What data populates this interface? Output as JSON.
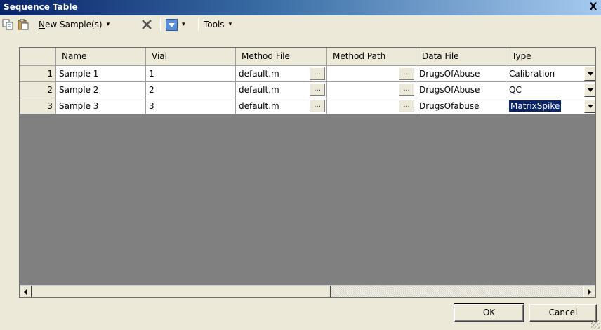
{
  "window": {
    "title": "Sequence Table",
    "close_glyph": "X"
  },
  "toolbar": {
    "copy_icon": "copy-icon",
    "paste_icon": "paste-icon",
    "new_sample_prefix": "N",
    "new_sample_rest": "ew Sample(s)",
    "delete_icon": "delete-x-icon",
    "insert_icon": "insert-down-icon",
    "tools_label": "Tools",
    "dropdown_glyph": "▾"
  },
  "table": {
    "columns": [
      "Name",
      "Vial",
      "Method File",
      "Method Path",
      "Data File",
      "Type"
    ],
    "ellipsis_label": "...",
    "rows": [
      {
        "num": "1",
        "name": "Sample 1",
        "vial": "1",
        "method_file": "default.m",
        "method_path": "",
        "data_file": "DrugsOfAbuse",
        "type": "Calibration"
      },
      {
        "num": "2",
        "name": "Sample 2",
        "vial": "2",
        "method_file": "default.m",
        "method_path": "",
        "data_file": "DrugsOfAbuse",
        "type": "QC"
      },
      {
        "num": "3",
        "name": "Sample 3",
        "vial": "3",
        "method_file": "default.m",
        "method_path": "",
        "data_file": "DrugsOfabuse",
        "type": "MatrixSpike"
      }
    ],
    "selected_row": 3
  },
  "buttons": {
    "ok_label": "OK",
    "cancel_label": "Cancel"
  },
  "colors": {
    "title_bar": "#0a246a",
    "selection": "#0a246a",
    "grid_empty": "#808080",
    "face": "#ece9d8"
  }
}
